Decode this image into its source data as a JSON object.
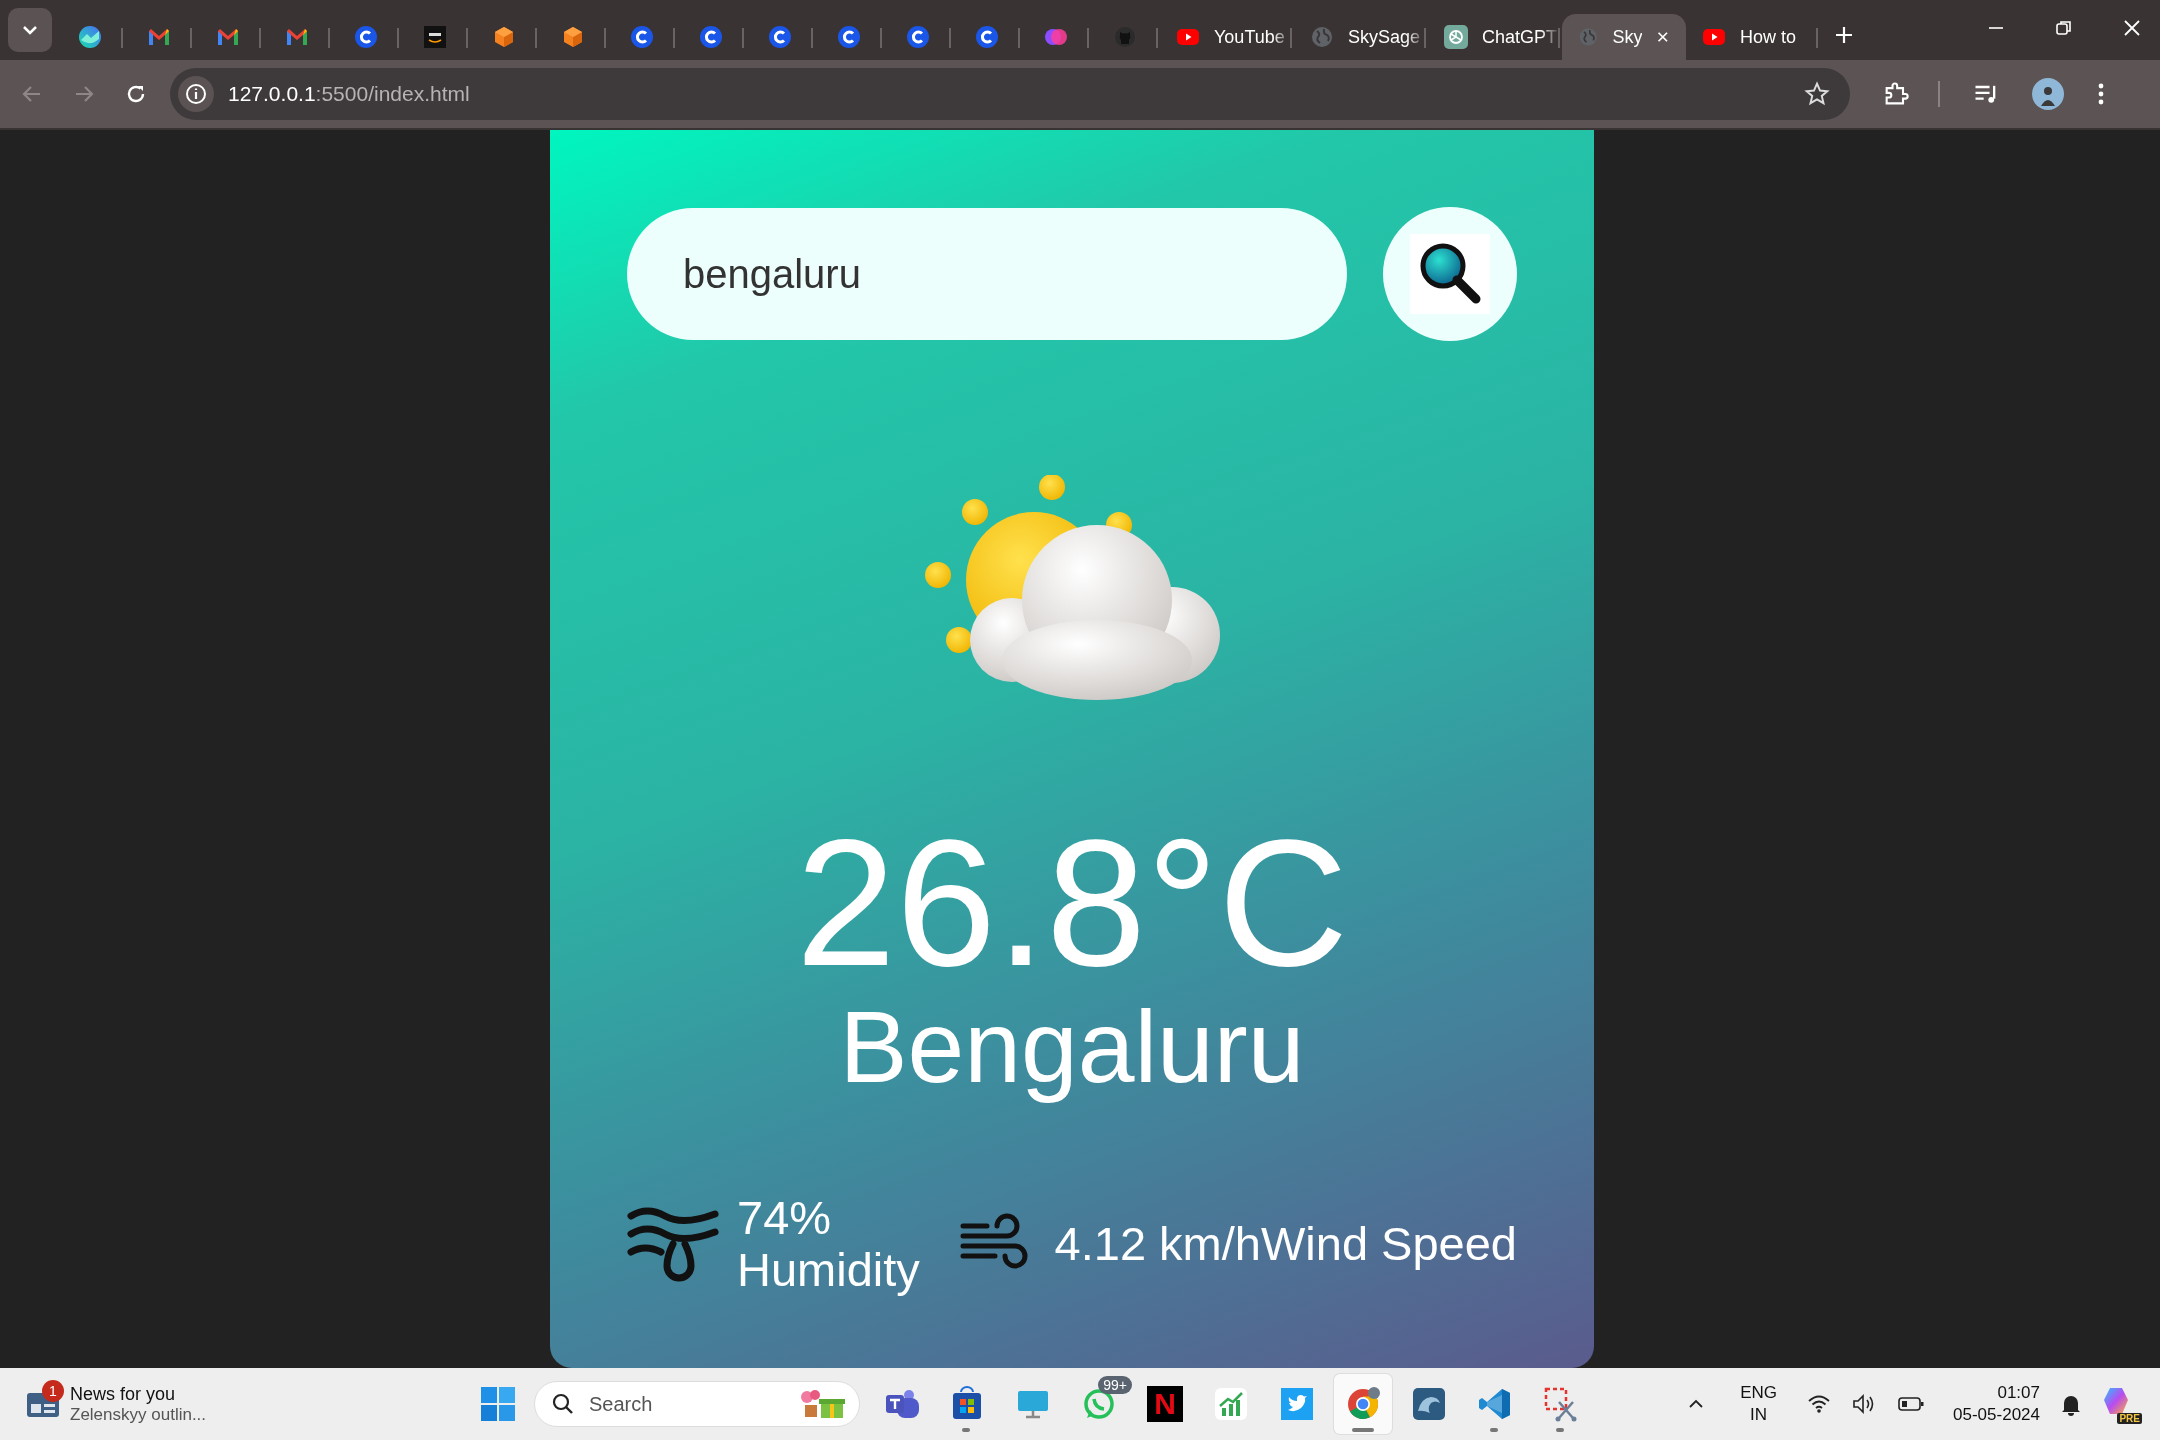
{
  "browser": {
    "tabs": [
      {
        "kind": "gradient",
        "selected": false
      },
      {
        "kind": "mail",
        "selected": false
      },
      {
        "kind": "mail",
        "selected": false
      },
      {
        "kind": "mail",
        "selected": false
      },
      {
        "kind": "c",
        "selected": false
      },
      {
        "kind": "aws",
        "selected": false
      },
      {
        "kind": "cube",
        "selected": false
      },
      {
        "kind": "cube",
        "selected": false
      },
      {
        "kind": "c",
        "selected": false
      },
      {
        "kind": "c",
        "selected": false
      },
      {
        "kind": "c",
        "selected": false
      },
      {
        "kind": "c",
        "selected": false
      },
      {
        "kind": "c",
        "selected": false
      },
      {
        "kind": "c",
        "selected": false
      },
      {
        "kind": "orb",
        "selected": false
      },
      {
        "kind": "github",
        "selected": false
      },
      {
        "kind": "youtube",
        "title": "YouTube",
        "selected": false
      },
      {
        "kind": "globe",
        "title": "SkySage",
        "selected": false
      },
      {
        "kind": "chatgpt",
        "title": "ChatGPT",
        "selected": false
      },
      {
        "kind": "globe",
        "title": "Sky",
        "selected": true
      },
      {
        "kind": "youtube",
        "title": "How to",
        "selected": false
      }
    ],
    "address": {
      "host": "127.0.0.1",
      "path": ":5500/index.html"
    }
  },
  "app": {
    "search": {
      "value": "bengaluru"
    },
    "temperature": "26.8°C",
    "city": "Bengaluru",
    "humidity": {
      "value": "74%",
      "label": "Humidity"
    },
    "wind": {
      "value": "4.12 km/h",
      "label": "Wind Speed"
    }
  },
  "taskbar": {
    "news": {
      "badge": "1",
      "title": "News for you",
      "subtitle": "Zelenskyy outlin..."
    },
    "search": {
      "placeholder": "Search"
    },
    "apps": [
      {
        "kind": "teams",
        "active": false,
        "running": false
      },
      {
        "kind": "store",
        "active": false,
        "running": true
      },
      {
        "kind": "monitor",
        "active": false,
        "running": false
      },
      {
        "kind": "whatsapp",
        "badge": "99+",
        "active": false,
        "running": false
      },
      {
        "kind": "netflix",
        "glyph": "N",
        "active": false,
        "running": false
      },
      {
        "kind": "chart",
        "active": false,
        "running": false
      },
      {
        "kind": "twitter",
        "active": false,
        "running": false
      },
      {
        "kind": "chrome",
        "active": true,
        "running": true
      },
      {
        "kind": "mysql",
        "active": false,
        "running": false
      },
      {
        "kind": "vscode",
        "active": false,
        "running": true
      },
      {
        "kind": "snip",
        "active": false,
        "running": true
      }
    ],
    "tray": {
      "language": "ENG",
      "region": "IN",
      "time": "01:07",
      "date": "05-05-2024",
      "copilot_badge": "PRE"
    }
  }
}
